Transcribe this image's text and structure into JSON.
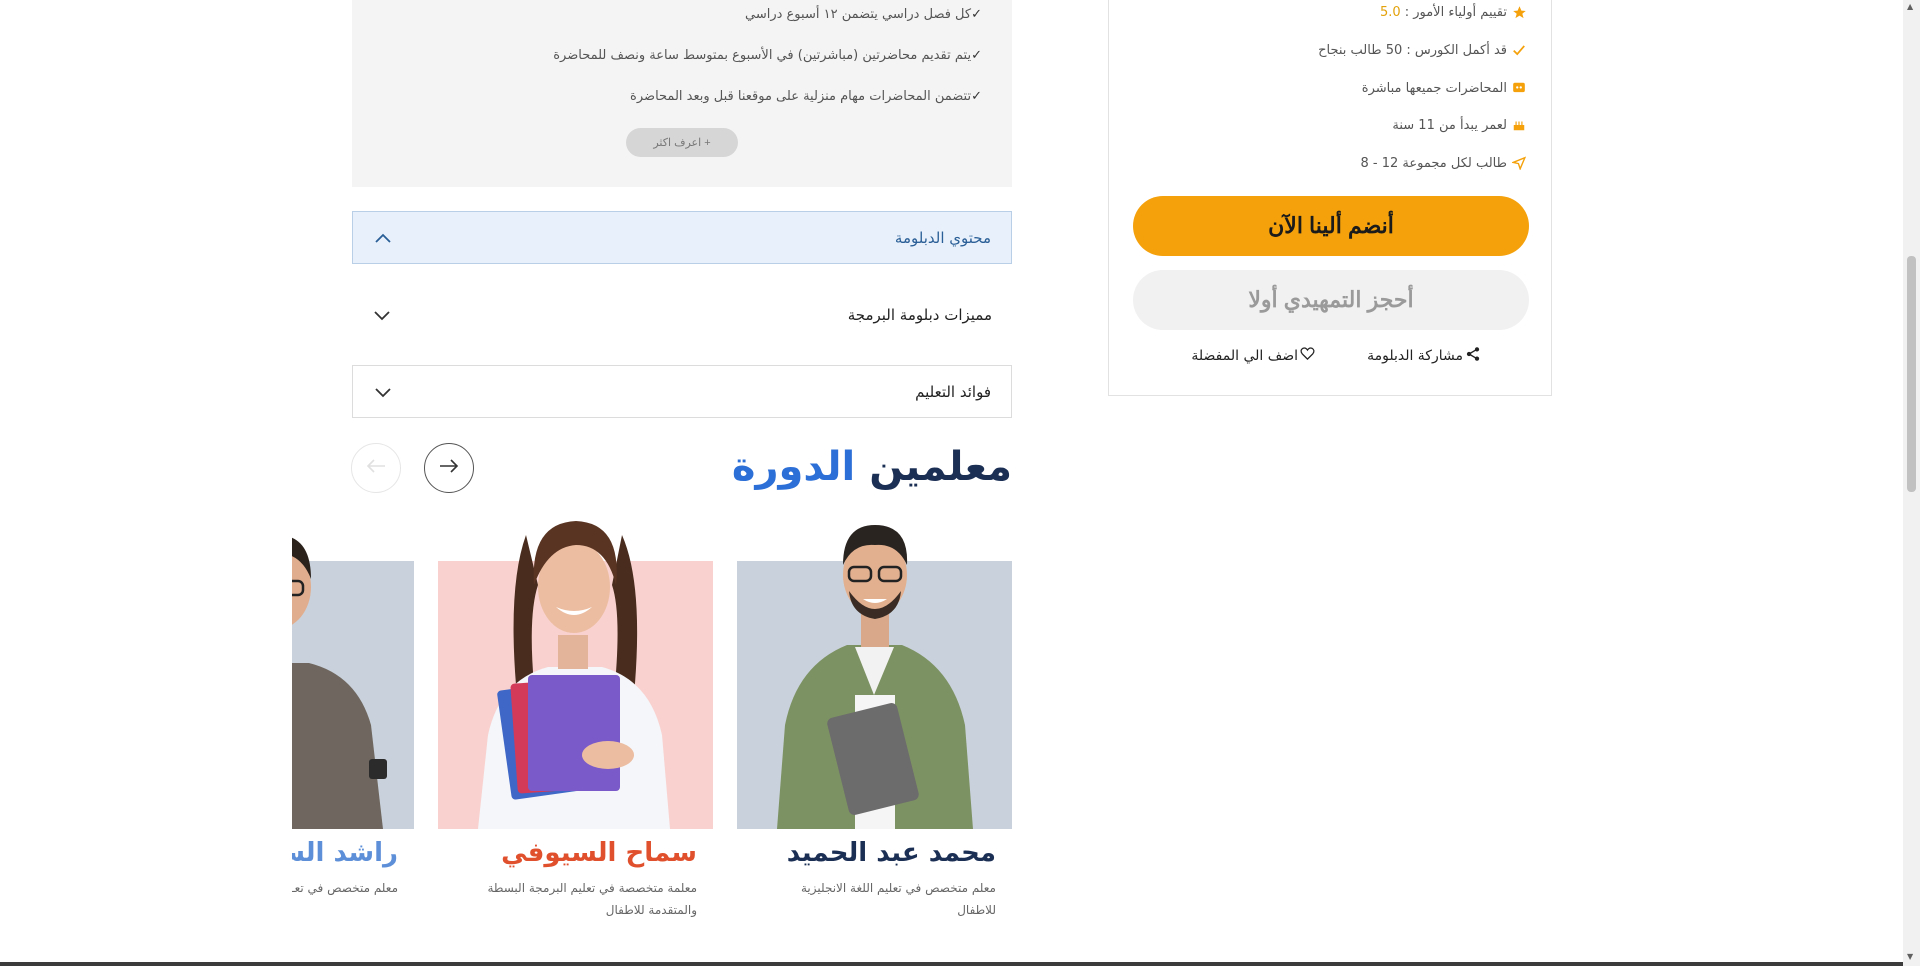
{
  "info_box": {
    "lines": [
      "كل فصل دراسي يتضمن ١٢ أسبوع دراسي",
      "يتم تقديم محاضرتين (مباشرتين) في الأسبوع بمتوسط ساعة ونصف للمحاضرة",
      "تتضمن المحاضرات مهام منزلية على موقعنا قبل وبعد المحاضرة"
    ],
    "check": "✓",
    "learn_more": "+ اعرف اكثر"
  },
  "accordion": [
    {
      "label": "محتوي الدبلومة",
      "state": "open"
    },
    {
      "label": "مميزات دبلومة البرمجة",
      "state": "closed"
    },
    {
      "label": "فوائد التعليم",
      "state": "closed"
    }
  ],
  "teachers_section": {
    "title_part1": "معلمين",
    "title_part2": "الدورة",
    "colors": {
      "dark": "#1b2f55",
      "blue": "#2c6fd6"
    },
    "teachers": [
      {
        "name": "محمد عبد الحميد",
        "desc": "معلم متخصص في تعليم اللغة الانجليزية للاطفال",
        "name_color": "#1b2f55",
        "bg": "#c9d2dc"
      },
      {
        "name": "سماح السيوفي",
        "desc": "معلمة متخصصة في تعليم البرمجة البسطة والمتقدمة للاطفال",
        "name_color": "#e0502d",
        "bg": "#f9d2cf"
      },
      {
        "name": "راشد السـ",
        "desc": "معلم متخصص في تعـ",
        "name_color": "#5d8fd8",
        "bg": "#c9d2dc"
      }
    ]
  },
  "sidebar": {
    "rating_label": "تقييم أولياء الأمور :",
    "rating_value": "5.0",
    "rows": [
      {
        "icon": "check-icon",
        "text": "قد أكمل الكورس : 50 طالب بنجاح"
      },
      {
        "icon": "live-icon",
        "text": "المحاضرات جميعها مباشرة"
      },
      {
        "icon": "cake-icon",
        "text": "لعمر يبدأ من 11 سنة"
      },
      {
        "icon": "send-icon",
        "text": "طالب لكل مجموعة 12 - 8"
      }
    ],
    "join_button": "أنضم ألينا الآن",
    "book_button": "أحجز التمهيدي أولا",
    "share_label": "مشاركة الدبلومة",
    "favorite_label": "اضف الي المفضلة",
    "accent": "#f4a10b"
  }
}
